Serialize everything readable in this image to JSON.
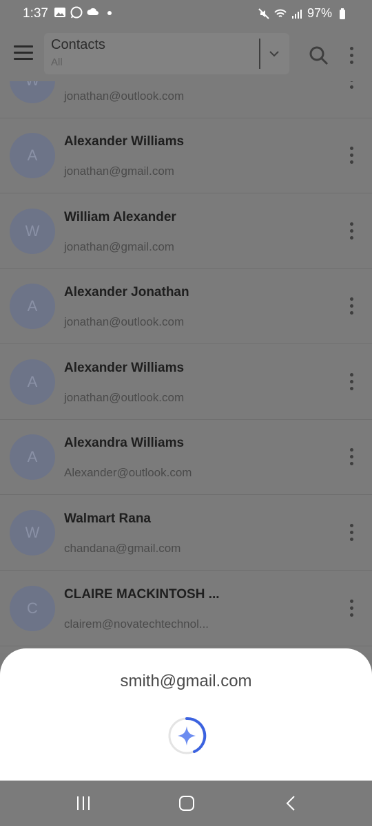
{
  "status": {
    "time": "1:37",
    "battery": "97%"
  },
  "appbar": {
    "title": "Contacts",
    "filter": "All"
  },
  "contacts": [
    {
      "initial": "W",
      "name": "",
      "email": "jonathan@outlook.com"
    },
    {
      "initial": "A",
      "name": "Alexander Williams",
      "email": "jonathan@gmail.com"
    },
    {
      "initial": "W",
      "name": "William Alexander",
      "email": "jonathan@gmail.com"
    },
    {
      "initial": "A",
      "name": "Alexander Jonathan",
      "email": "jonathan@outlook.com"
    },
    {
      "initial": "A",
      "name": "Alexander Williams",
      "email": "jonathan@outlook.com"
    },
    {
      "initial": "A",
      "name": "Alexandra Williams",
      "email": "Alexander@outlook.com"
    },
    {
      "initial": "W",
      "name": "Walmart Rana",
      "email": "chandana@gmail.com"
    },
    {
      "initial": "C",
      "name": "CLAIRE MACKINTOSH ...",
      "email": "clairem@novatechtechnol..."
    }
  ],
  "sheet": {
    "email": "smith@gmail.com"
  },
  "colors": {
    "accent": "#3b62e0",
    "spark": "#6c8cf0"
  }
}
